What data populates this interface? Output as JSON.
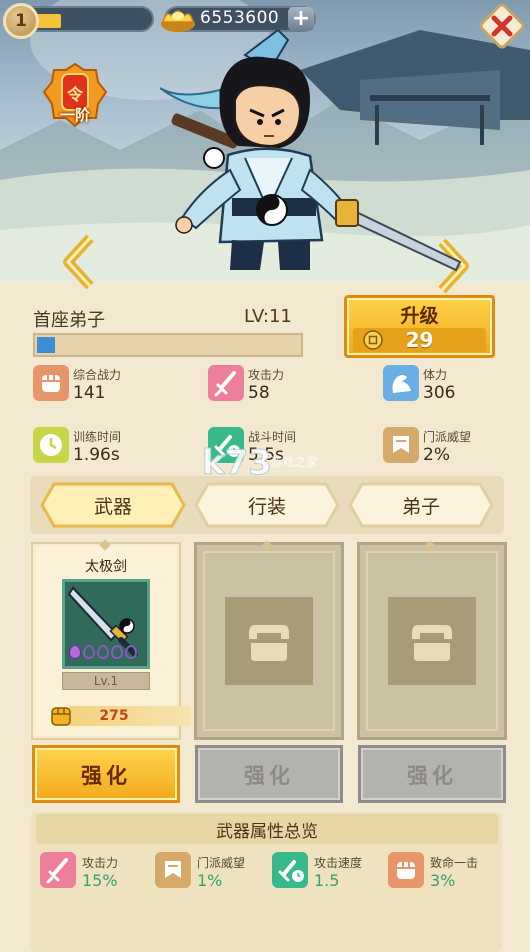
{
  "hud": {
    "player_level": "1",
    "player_level_progress": 0.17,
    "gold": "6553600",
    "gold_add_symbol": "+"
  },
  "rank_badge": {
    "seal_char": "令",
    "rank_text": "一阶"
  },
  "disciple": {
    "title": "首座弟子",
    "level": "LV:11",
    "exp_progress": 0.07
  },
  "upgrade": {
    "label": "升级",
    "cost": "29"
  },
  "stats": [
    {
      "label": "综合战力",
      "value": "141",
      "icon": "fist-icon",
      "color": "#e8956a"
    },
    {
      "label": "攻击力",
      "value": "58",
      "icon": "sword-icon",
      "color": "#ee7f9a"
    },
    {
      "label": "体力",
      "value": "306",
      "icon": "arm-icon",
      "color": "#6aaee3"
    },
    {
      "label": "训练时间",
      "value": "1.96s",
      "icon": "clock-icon",
      "color": "#c9d64a"
    },
    {
      "label": "战斗时间",
      "value": "5.5s",
      "icon": "sword-clock-icon",
      "color": "#37b98a"
    },
    {
      "label": "门派威望",
      "value": "2%",
      "icon": "banner-icon",
      "color": "#d6a96a"
    }
  ],
  "watermark": {
    "text": "k73",
    "subtext": "游戏之家"
  },
  "tabs": [
    {
      "label": "武器",
      "selected": true
    },
    {
      "label": "行装",
      "selected": false
    },
    {
      "label": "弟子",
      "selected": false
    }
  ],
  "weapon": {
    "name": "太极剑",
    "level": "Lv.1",
    "power": "275",
    "stars": 5
  },
  "strengthen": [
    {
      "label": "强化",
      "enabled": true
    },
    {
      "label": "强化",
      "enabled": false
    },
    {
      "label": "强化",
      "enabled": false
    }
  ],
  "summary": {
    "title": "武器属性总览",
    "stats": [
      {
        "label": "攻击力",
        "value": "15%",
        "icon": "sword-icon",
        "color": "#ee7f9a"
      },
      {
        "label": "门派威望",
        "value": "1%",
        "icon": "banner-icon",
        "color": "#d6a96a"
      },
      {
        "label": "攻击速度",
        "value": "1.5",
        "icon": "sword-clock-icon",
        "color": "#37b98a"
      },
      {
        "label": "致命一击",
        "value": "3%",
        "icon": "fist-icon",
        "color": "#e8956a"
      }
    ]
  }
}
